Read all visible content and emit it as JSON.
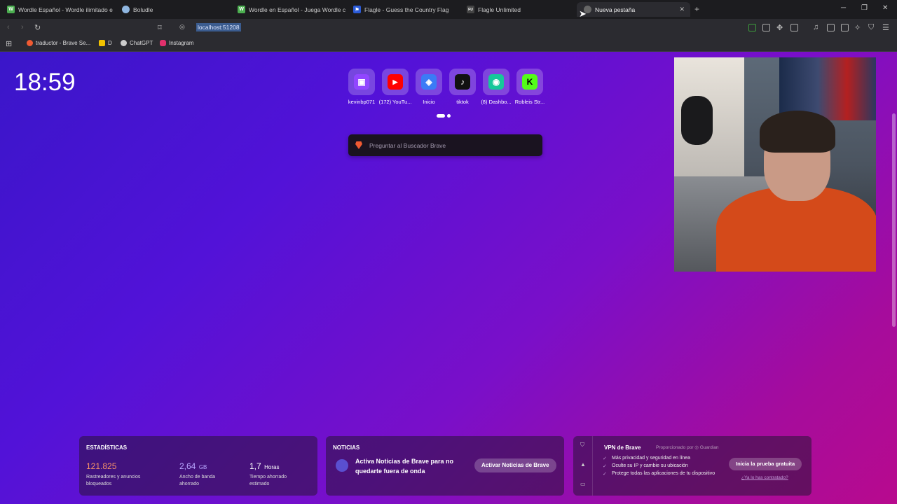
{
  "tabs": [
    {
      "title": "Wordle Español - Wordle ilimitado e",
      "favicon": "W",
      "color": "#4caf50"
    },
    {
      "title": "Boludle",
      "favicon": "",
      "color": "#8fb6e0"
    },
    {
      "title": "Wordle en Español - Juega Wordle c",
      "favicon": "W",
      "color": "#4caf50"
    },
    {
      "title": "Flagle - Guess the Country Flag",
      "favicon": "⚑",
      "color": "#2b5bd8"
    },
    {
      "title": "Flagle Unlimited",
      "favicon": "FU",
      "color": "#444"
    },
    {
      "title": "Nueva pestaña",
      "favicon": "",
      "color": "#666"
    }
  ],
  "toolbar": {
    "url": "localhost:51208"
  },
  "bookmarks": [
    {
      "label": "traductor - Brave Se...",
      "color": "#f05a32"
    },
    {
      "label": "D",
      "color": "#f2c200"
    },
    {
      "label": "ChatGPT",
      "color": "#ccc"
    },
    {
      "label": "Instagram",
      "color": "#e1306c"
    }
  ],
  "ntp": {
    "clock": "18:59",
    "search_placeholder": "Preguntar al Buscador Brave"
  },
  "top_sites": [
    {
      "label": "kevinbp071",
      "color": "#9146ff",
      "glyph": "▣"
    },
    {
      "label": "(172) YouTu...",
      "color": "#ff0000",
      "glyph": "▶"
    },
    {
      "label": "Inicio",
      "color": "#3b7bf6",
      "glyph": "◈"
    },
    {
      "label": "tiktok",
      "color": "#111111",
      "glyph": "♪"
    },
    {
      "label": "(8) Dashbo...",
      "color": "#16c79a",
      "glyph": "◉"
    },
    {
      "label": "Robleis Str...",
      "color": "#53fc18",
      "glyph": "K"
    }
  ],
  "stats": {
    "title": "ESTADÍSTICAS",
    "trackers_value": "121.825",
    "trackers_desc_1": "Rastreadores y anuncios",
    "trackers_desc_2": "bloqueados",
    "bandwidth_value": "2,64",
    "bandwidth_unit": "GB",
    "bandwidth_desc_1": "Ancho de banda",
    "bandwidth_desc_2": "ahorrado",
    "time_value": "1,7",
    "time_unit": "Horas",
    "time_desc_1": "Tiempo ahorrado",
    "time_desc_2": "estimado"
  },
  "news": {
    "title": "NOTICIAS",
    "text": "Activa Noticias de Brave para no quedarte fuera de onda",
    "button": "Activar Noticias de Brave"
  },
  "vpn": {
    "title": "VPN de Brave",
    "provided_by": "Proporcionado por ◎ Guardian",
    "features": [
      "Más privacidad y seguridad en línea",
      "Oculte su IP y cambie su ubicación",
      "Protege todas las aplicaciones de tu dispositivo"
    ],
    "button": "Inicia la prueba gratuita",
    "link": "¿Ya lo has contratado?"
  },
  "colors": {
    "stats_trackers": "#f5906a",
    "stats_bandwidth": "#b9a7ff",
    "stats_time": "#ffffff"
  }
}
